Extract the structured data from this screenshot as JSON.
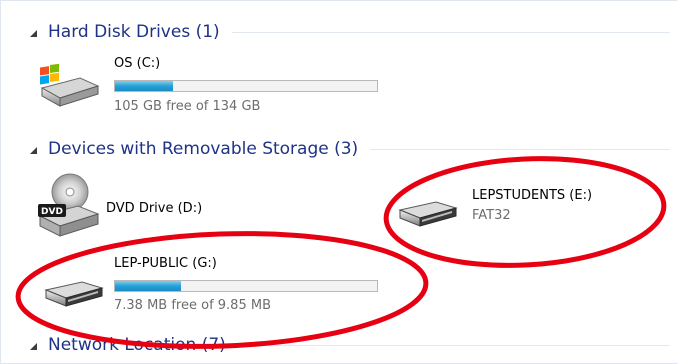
{
  "groups": {
    "hard_disk": {
      "label": "Hard Disk Drives (1)"
    },
    "removable": {
      "label": "Devices with Removable Storage (3)"
    },
    "network": {
      "label": "Network Location (7)"
    }
  },
  "drives": {
    "os_c": {
      "name": "OS (C:)",
      "space": "105 GB free of 134 GB",
      "used_fraction": 0.22
    },
    "dvd_d": {
      "name": "DVD Drive (D:)",
      "icon_label": "DVD"
    },
    "lepstudents_e": {
      "name": "LEPSTUDENTS (E:)",
      "filesystem": "FAT32"
    },
    "lep_public_g": {
      "name": "LEP-PUBLIC (G:)",
      "space": "7.38 MB free of 9.85 MB",
      "used_fraction": 0.25
    }
  },
  "colors": {
    "group_header": "#1e3287",
    "annotation_circle": "#e60012",
    "bar_fill": "#26a0da"
  }
}
